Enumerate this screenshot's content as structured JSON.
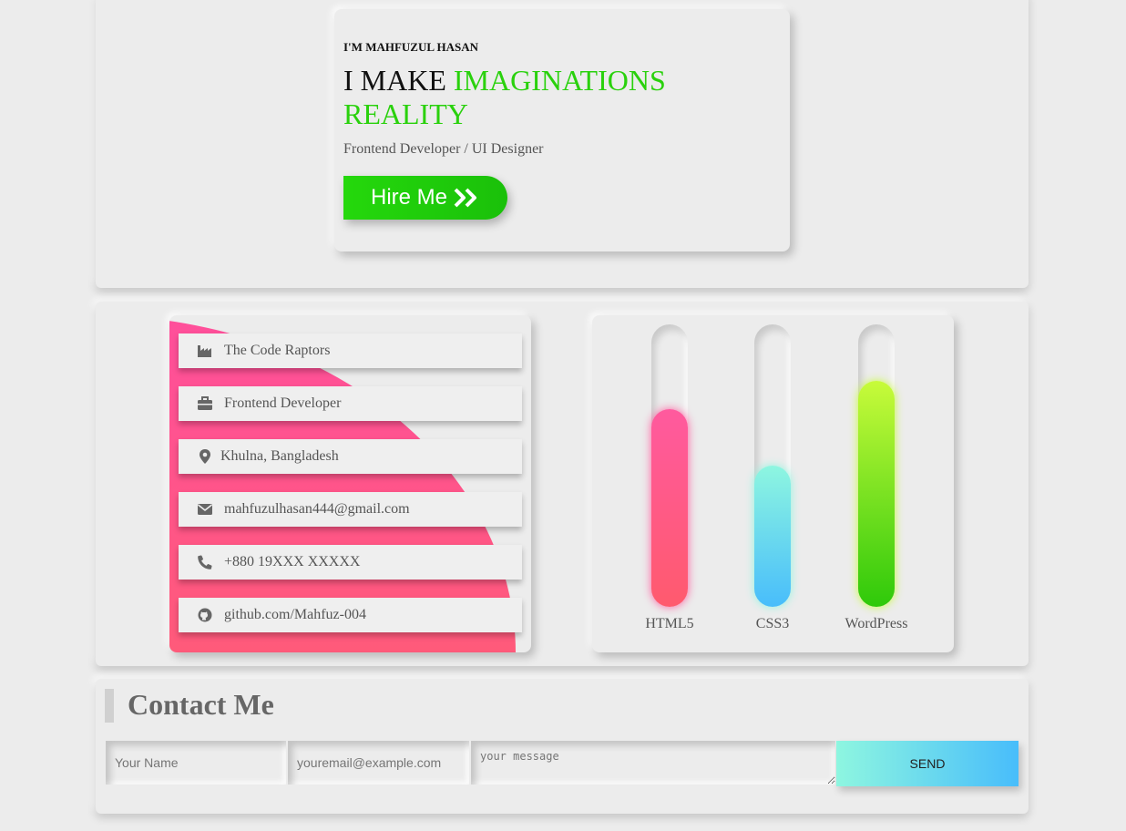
{
  "hero": {
    "intro": "I'M MAHFUZUL HASAN",
    "title_plain": "I MAKE ",
    "title_accent": "IMAGINATIONS REALITY",
    "subtitle": "Frontend Developer / UI Designer",
    "hire_label": "Hire Me",
    "hire_icon": "double-chevron-right-icon",
    "accent_color": "#2ad10d"
  },
  "info": {
    "items": [
      {
        "icon": "industry-icon",
        "text": "The Code Raptors"
      },
      {
        "icon": "briefcase-icon",
        "text": "Frontend Developer"
      },
      {
        "icon": "map-marker-icon",
        "text": "Khulna, Bangladesh"
      },
      {
        "icon": "envelope-icon",
        "text": "mahfuzulhasan444@gmail.com"
      },
      {
        "icon": "phone-icon",
        "text": "+880 19XXX XXXXX"
      },
      {
        "icon": "github-icon",
        "text": "github.com/Mahfuz-004"
      }
    ]
  },
  "skills": {
    "items": [
      {
        "label": "HTML5",
        "level": 0.7,
        "colors": [
          "#ff5a9e",
          "#ff5a6e"
        ]
      },
      {
        "label": "CSS3",
        "level": 0.5,
        "colors": [
          "#8ef6e0",
          "#48bdfb"
        ]
      },
      {
        "label": "WordPress",
        "level": 0.8,
        "colors": [
          "#c8fb3a",
          "#2ec90a"
        ]
      }
    ]
  },
  "contact": {
    "title": "Contact Me",
    "name_placeholder": "Your Name",
    "email_placeholder": "youremail@example.com",
    "message_placeholder": "your message",
    "send_label": "SEND"
  }
}
